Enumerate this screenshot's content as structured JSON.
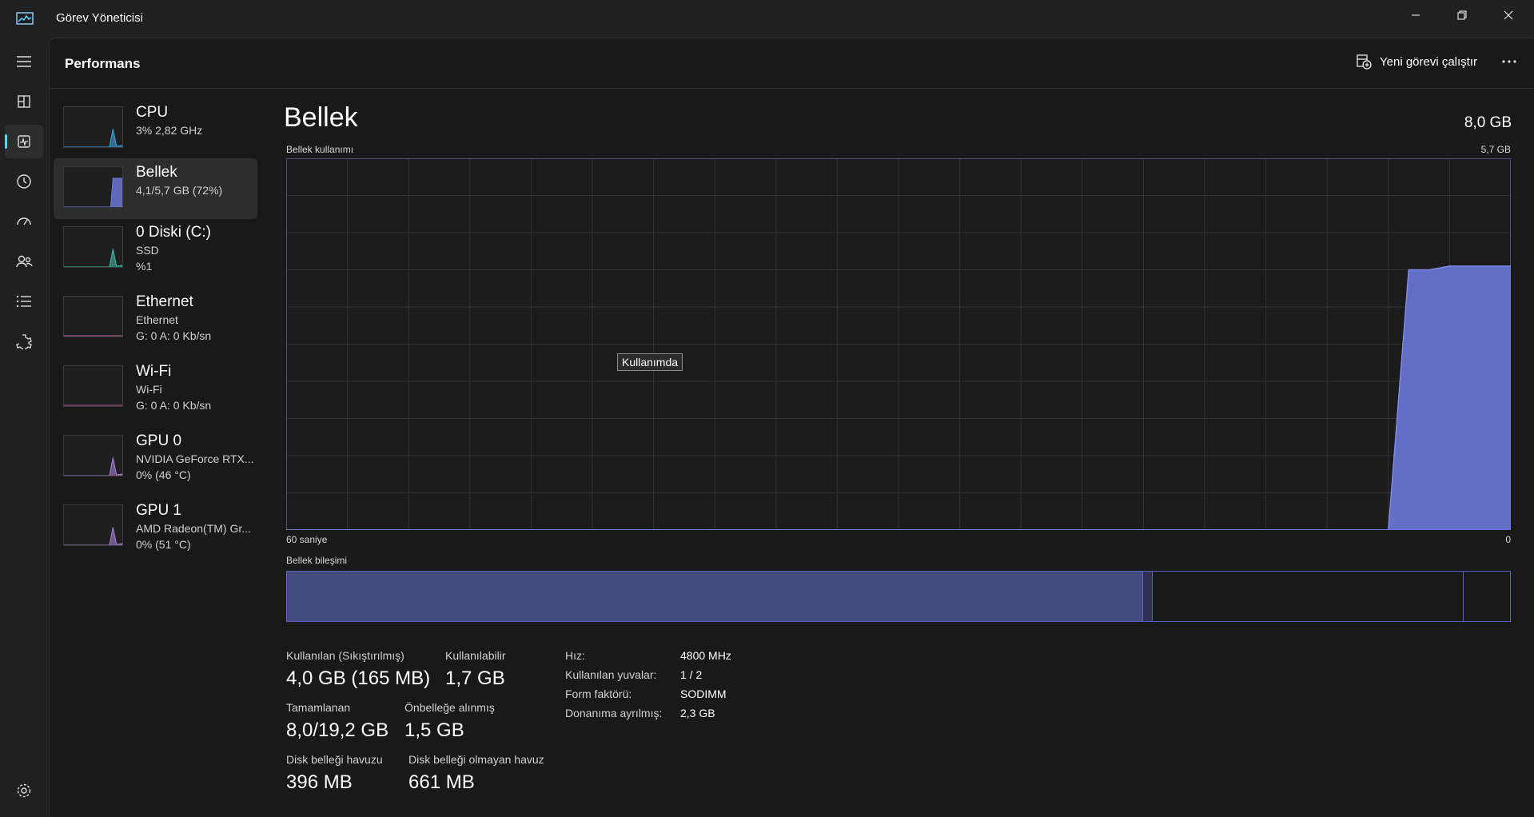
{
  "window": {
    "title": "Görev Yöneticisi"
  },
  "header": {
    "title": "Performans",
    "run_task_label": "Yeni görevi çalıştır"
  },
  "nav": {
    "items": [
      "menu-icon",
      "processes-icon",
      "performance-icon",
      "app-history-icon",
      "startup-icon",
      "users-icon",
      "details-icon",
      "services-icon",
      "settings-icon"
    ],
    "active": "performance-icon"
  },
  "devices": [
    {
      "name": "CPU",
      "line1": "3%  2,82 GHz",
      "line2": "",
      "color": "#3aa7e0",
      "level": 0.03
    },
    {
      "name": "Bellek",
      "line1": "4,1/5,7 GB (72%)",
      "line2": "",
      "color": "#6c78d8",
      "level": 0.72
    },
    {
      "name": "0 Diski (C:)",
      "line1": "SSD",
      "line2": "%1",
      "color": "#3fb7a0",
      "level": 0.01
    },
    {
      "name": "Ethernet",
      "line1": "Ethernet",
      "line2": "G: 0  A: 0 Kb/sn",
      "color": "#c05fa0",
      "level": 0
    },
    {
      "name": "Wi-Fi",
      "line1": "Wi-Fi",
      "line2": "G: 0  A: 0 Kb/sn",
      "color": "#c05fa0",
      "level": 0
    },
    {
      "name": "GPU 0",
      "line1": "NVIDIA GeForce RTX...",
      "line2": "0%  (46 °C)",
      "color": "#a57fd6",
      "level": 0
    },
    {
      "name": "GPU 1",
      "line1": "AMD Radeon(TM) Gr...",
      "line2": "0%  (51 °C)",
      "color": "#a57fd6",
      "level": 0
    }
  ],
  "memory": {
    "title": "Bellek",
    "total": "8,0 GB",
    "usage_label": "Bellek kullanımı",
    "usage_max": "5,7 GB",
    "time_left": "60 saniye",
    "time_right": "0",
    "composition_label": "Bellek bileşimi",
    "tooltip": "Kullanımda",
    "usage_fraction_history": [
      0,
      0,
      0,
      0,
      0,
      0,
      0,
      0,
      0,
      0,
      0,
      0,
      0,
      0,
      0,
      0,
      0,
      0,
      0,
      0,
      0,
      0,
      0,
      0,
      0,
      0,
      0,
      0,
      0,
      0,
      0,
      0,
      0,
      0,
      0,
      0,
      0,
      0,
      0,
      0,
      0,
      0,
      0,
      0,
      0,
      0,
      0,
      0,
      0,
      0,
      0,
      0,
      0,
      0,
      0,
      0.7,
      0.7,
      0.71,
      0.71,
      0.71,
      0.71
    ],
    "composition_fractions": {
      "in_use": 0.7,
      "modified": 0.008,
      "standby": 0.254,
      "free": 0.038
    },
    "stats": [
      {
        "label": "Kullanılan (Sıkıştırılmış)",
        "value": "4,0 GB (165 MB)"
      },
      {
        "label": "Kullanılabilir",
        "value": "1,7 GB"
      },
      {
        "label": "Tamamlanan",
        "value": "8,0/19,2 GB"
      },
      {
        "label": "Önbelleğe alınmış",
        "value": "1,5 GB"
      },
      {
        "label": "Disk belleği havuzu",
        "value": "396 MB"
      },
      {
        "label": "Disk belleği olmayan havuz",
        "value": "661 MB"
      }
    ],
    "properties": [
      {
        "label": "Hız:",
        "value": "4800 MHz"
      },
      {
        "label": "Kullanılan yuvalar:",
        "value": "1 / 2"
      },
      {
        "label": "Form faktörü:",
        "value": "SODIMM"
      },
      {
        "label": "Donanıma ayrılmış:",
        "value": "2,3 GB"
      }
    ]
  },
  "colors": {
    "accent": "#60cdff",
    "memory_fill": "#6c78d8",
    "memory_line": "#7f8ae8",
    "grid": "#333333"
  }
}
